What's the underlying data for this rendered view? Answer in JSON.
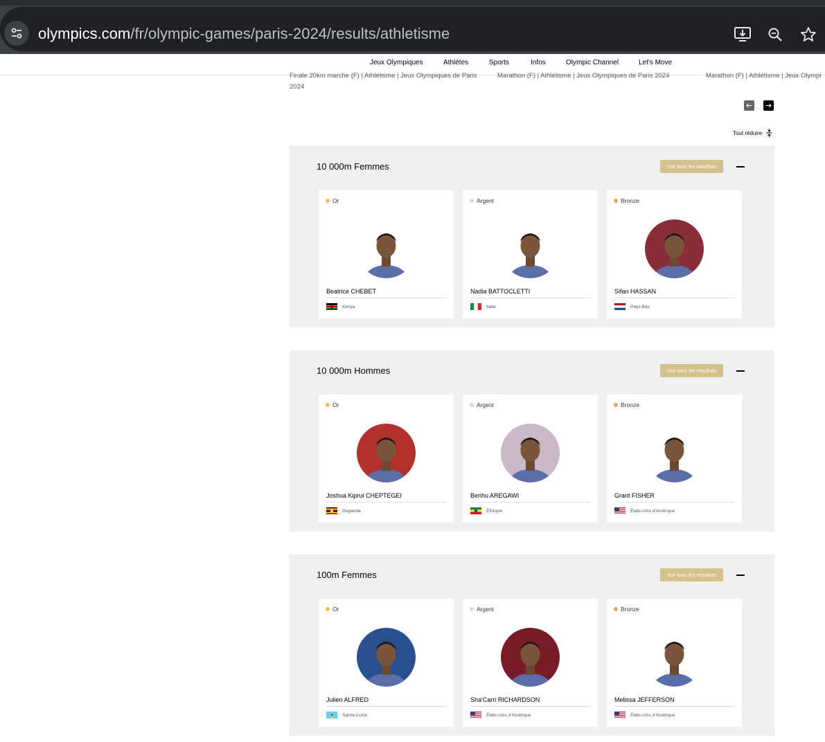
{
  "browser": {
    "url_host": "olympics.com",
    "url_path": "/fr/olympic-games/paris-2024/results/athletisme",
    "icons": [
      "tune-icon",
      "install-icon",
      "zoom-icon",
      "star-icon"
    ]
  },
  "nav": {
    "items": [
      "Jeux Olympiques",
      "Athlètes",
      "Sports",
      "Infos",
      "Olympic Channel",
      "Let's Move"
    ]
  },
  "carousel": {
    "items": [
      "Finale 20km marche (F) | Athlétisme | Jeux Olympiques de Paris 2024",
      "Marathon (F) | Athlétisme | Jeux Olympiques de Paris 2024",
      "Marathon (F) | Athlétisme | Jeux Olympi"
    ],
    "prev_icon": "arrow-left-icon",
    "next_icon": "arrow-right-icon"
  },
  "collapse_all_label": "Tout réduire",
  "results_button_label": "Voir tous les résultats",
  "medals": {
    "gold": "Or",
    "silver": "Argent",
    "bronze": "Bronze",
    "colors": {
      "gold": "#e7bf5e",
      "silver": "#d9d9d9",
      "bronze": "#d9a66c"
    }
  },
  "events": [
    {
      "title": "10 000m Femmes",
      "results": [
        {
          "name": "Beatrice CHEBET",
          "country": "Kenya",
          "flag": "kenya",
          "photo_bg": "#ffffff"
        },
        {
          "name": "Nadia BATTOCLETTI",
          "country": "Italie",
          "flag": "italy",
          "photo_bg": "#ffffff"
        },
        {
          "name": "Sifan HASSAN",
          "country": "Pays-Bas",
          "flag": "netherlands",
          "photo_bg": "#8a2d3a"
        }
      ]
    },
    {
      "title": "10 000m Hommes",
      "results": [
        {
          "name": "Joshua Kiprui CHEPTEGEI",
          "country": "Ouganda",
          "flag": "uganda",
          "photo_bg": "#b3312b"
        },
        {
          "name": "Berihu AREGAWI",
          "country": "Éthiopie",
          "flag": "ethiopia",
          "photo_bg": "#c9b8c8"
        },
        {
          "name": "Grant FISHER",
          "country": "États-Unis d'Amérique",
          "flag": "usa",
          "photo_bg": "#ffffff"
        }
      ]
    },
    {
      "title": "100m Femmes",
      "results": [
        {
          "name": "Julien ALFRED",
          "country": "Sainte-Lucie",
          "flag": "saint-lucia",
          "photo_bg": "#2a4f8f"
        },
        {
          "name": "Sha'Carri RICHARDSON",
          "country": "États-Unis d'Amérique",
          "flag": "usa",
          "photo_bg": "#7a1b2a"
        },
        {
          "name": "Melissa JEFFERSON",
          "country": "États-Unis d'Amérique",
          "flag": "usa",
          "photo_bg": "#ffffff"
        }
      ]
    }
  ]
}
